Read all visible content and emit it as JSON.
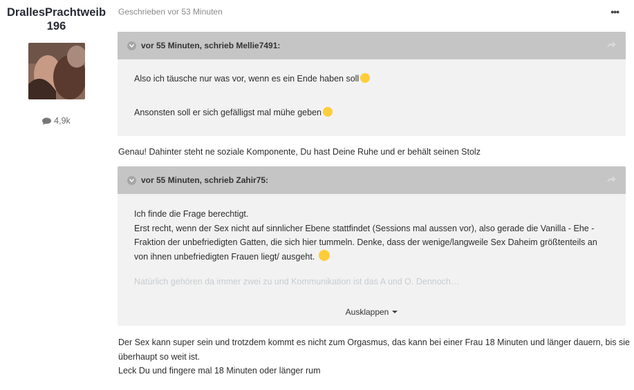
{
  "author": {
    "name": "DrallesPrachtweib196",
    "post_count": "4,9k"
  },
  "post": {
    "time": "Geschrieben vor 53 Minuten"
  },
  "quote1": {
    "header": "vor 55 Minuten, schrieb Mellie7491:",
    "line1": "Also ich täusche nur was vor, wenn es ein Ende haben soll",
    "line2": "Ansonsten soll er sich gefälligst mal mühe geben"
  },
  "reply1": "Genau! Dahinter steht ne soziale Komponente, Du hast Deine Ruhe und er behält seinen Stolz",
  "quote2": {
    "header": "vor 55 Minuten, schrieb Zahir75:",
    "lines": [
      "Ich finde die Frage berechtigt.",
      "Erst recht, wenn der Sex nicht auf sinnlicher Ebene stattfindet (Sessions mal aussen vor), also gerade die Vanilla - Ehe -",
      "Fraktion der unbefriedigten Gatten, die sich hier tummeln. Denke, dass der wenige/langweile Sex Daheim größtenteils an",
      "von ihnen unbefriedigten Frauen liegt/ ausgeht."
    ],
    "faded": "Natürlich gehören da immer zwei zu und Kommunikation ist das A und O. Dennoch…",
    "expand_label": "Ausklappen"
  },
  "reply2": {
    "line1": "Der Sex kann super sein und trotzdem kommt es nicht zum Orgasmus, das kann bei einer Frau 18 Minuten und länger dauern, bis sie",
    "line2": "überhaupt so weit ist.",
    "line3": "Leck Du und fingere mal 18 Minuten oder länger rum"
  }
}
